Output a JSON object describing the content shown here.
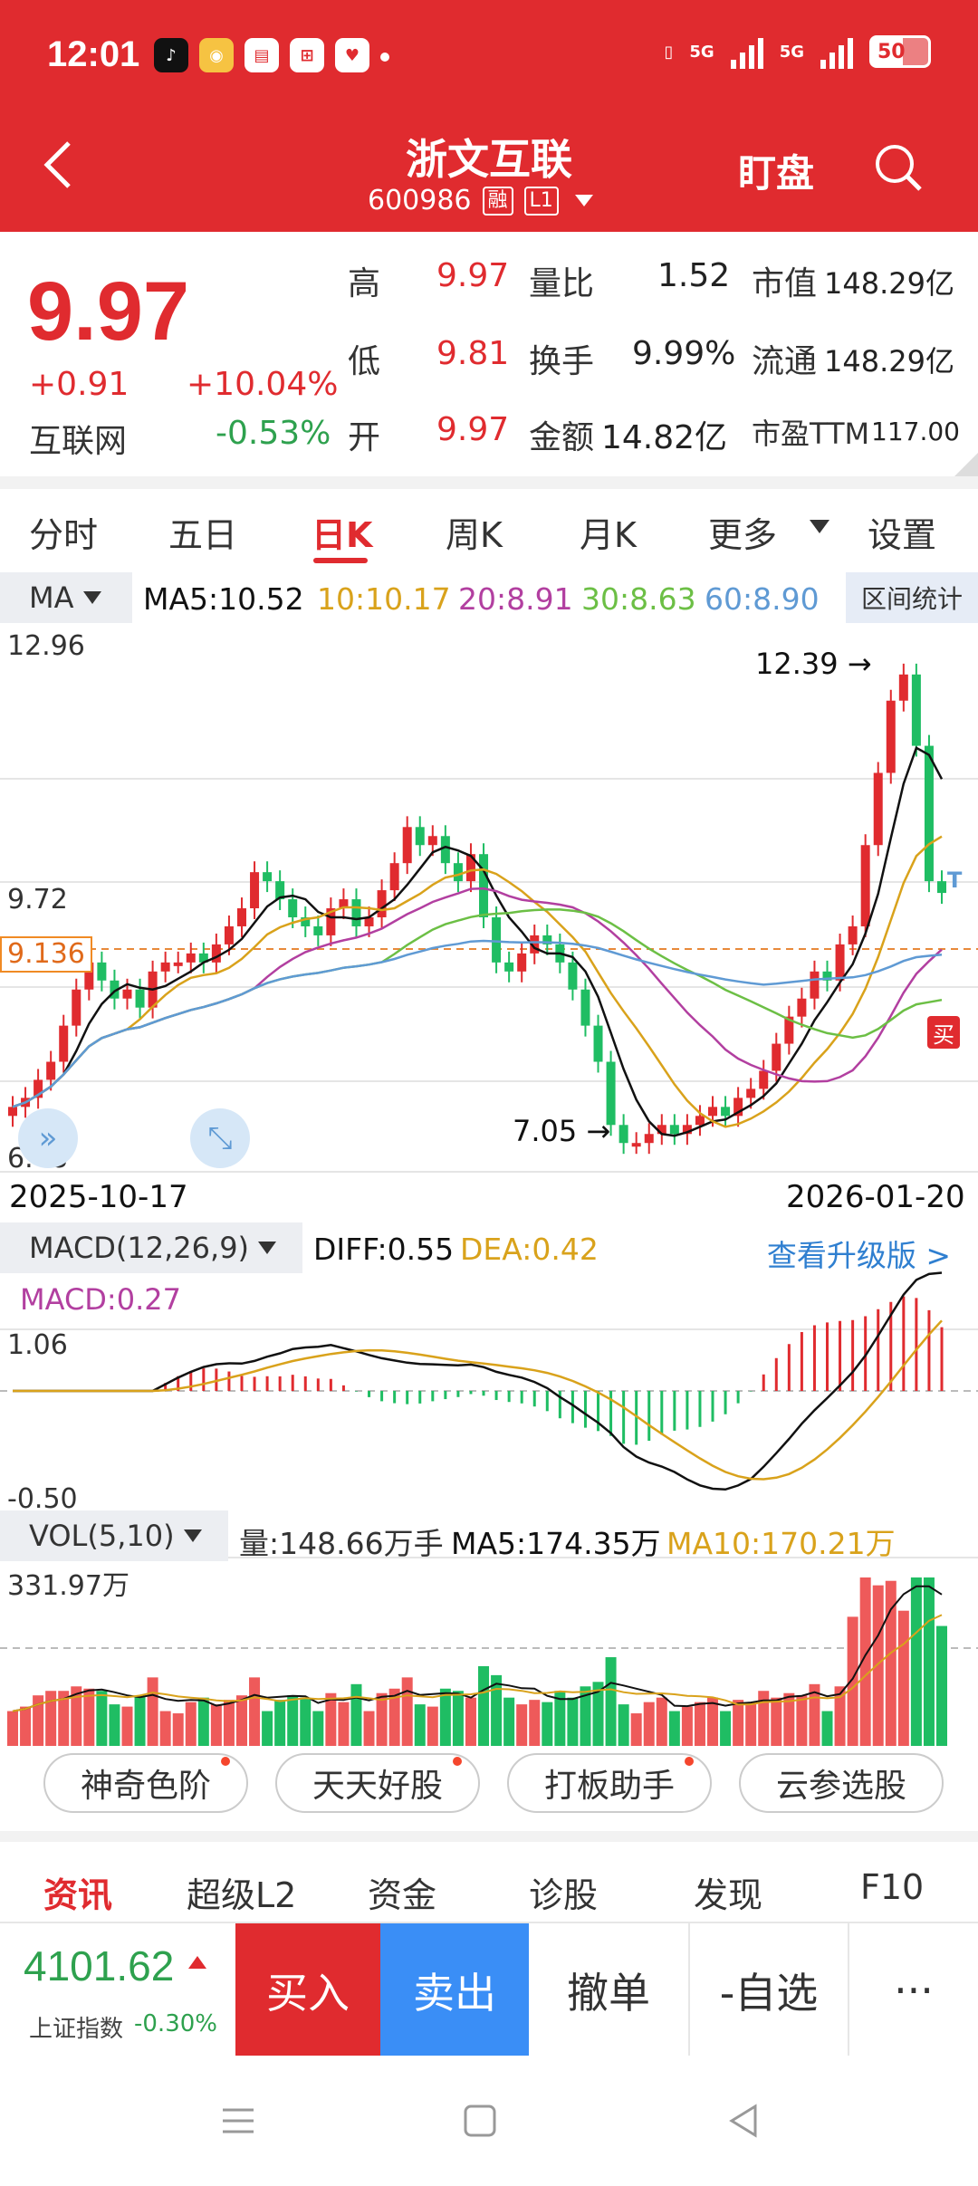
{
  "status_bar": {
    "time": "12:01",
    "network1": "5G",
    "network2": "5G",
    "battery": "50"
  },
  "header": {
    "stock_name": "浙文互联",
    "stock_code": "600986",
    "tag_margin": "融",
    "tag_level": "L1",
    "watch_label": "盯盘"
  },
  "quote": {
    "price": "9.97",
    "change": "+0.91",
    "change_pct": "+10.04%",
    "sector": "互联网",
    "sector_pct": "-0.53%",
    "rows": [
      {
        "l1": "高",
        "v1": "9.97",
        "l2": "量比",
        "v2": "1.52",
        "l3": "市值",
        "v3": "148.29亿"
      },
      {
        "l1": "低",
        "v1": "9.81",
        "l2": "换手",
        "v2": "9.99%",
        "l3": "流通",
        "v3": "148.29亿"
      },
      {
        "l1": "开",
        "v1": "9.97",
        "l2": "金额",
        "v2": "14.82亿",
        "l3": "市盈TTM",
        "v3": "117.00"
      }
    ]
  },
  "period_tabs": [
    "分时",
    "五日",
    "日K",
    "周K",
    "月K",
    "更多",
    "设置"
  ],
  "ma": {
    "label": "MA",
    "ma5": "MA5:10.52",
    "ma10": "10:10.17",
    "ma20": "20:8.91",
    "ma30": "30:8.63",
    "ma60": "60:8.90",
    "range_stat": "区间统计"
  },
  "kline": {
    "y_top": "12.96",
    "y_mid": "9.72",
    "y_bottom": "6.48",
    "ref_price": "9.136",
    "date_start": "2025-10-17",
    "date_end": "2026-01-20",
    "high_annotation": "12.39",
    "low_annotation": "7.05",
    "buy_tag": "买",
    "marker_t": "T"
  },
  "macd": {
    "label": "MACD(12,26,9)",
    "diff": "DIFF:0.55",
    "dea": "DEA:0.42",
    "macd": "MACD:0.27",
    "upgrade": "查看升级版 >",
    "y_top": "1.06",
    "y_bottom": "-0.50"
  },
  "volume": {
    "label": "VOL(5,10)",
    "vol": "量:148.66万手",
    "ma5": "MA5:174.35万",
    "ma10": "MA10:170.21万",
    "y_top": "331.97万"
  },
  "tool_chips": [
    "神奇色阶",
    "天天好股",
    "打板助手",
    "云参选股"
  ],
  "info_tabs": [
    "资讯",
    "超级L2",
    "资金",
    "诊股",
    "发现",
    "F10"
  ],
  "trade_bar": {
    "index_value": "4101.62",
    "index_name": "上证指数",
    "index_pct": "-0.30%",
    "buy": "买入",
    "sell": "卖出",
    "cancel": "撤单",
    "favorite": "-自选",
    "more": "···"
  },
  "colors": {
    "red": "#e02b2f",
    "green": "#1fbd63",
    "blue": "#3a8ef6",
    "ma5": "#111111",
    "ma10": "#d9a21b",
    "ma20": "#b23fa0",
    "ma30": "#6cbf45",
    "ma60": "#5f9ad4"
  }
}
